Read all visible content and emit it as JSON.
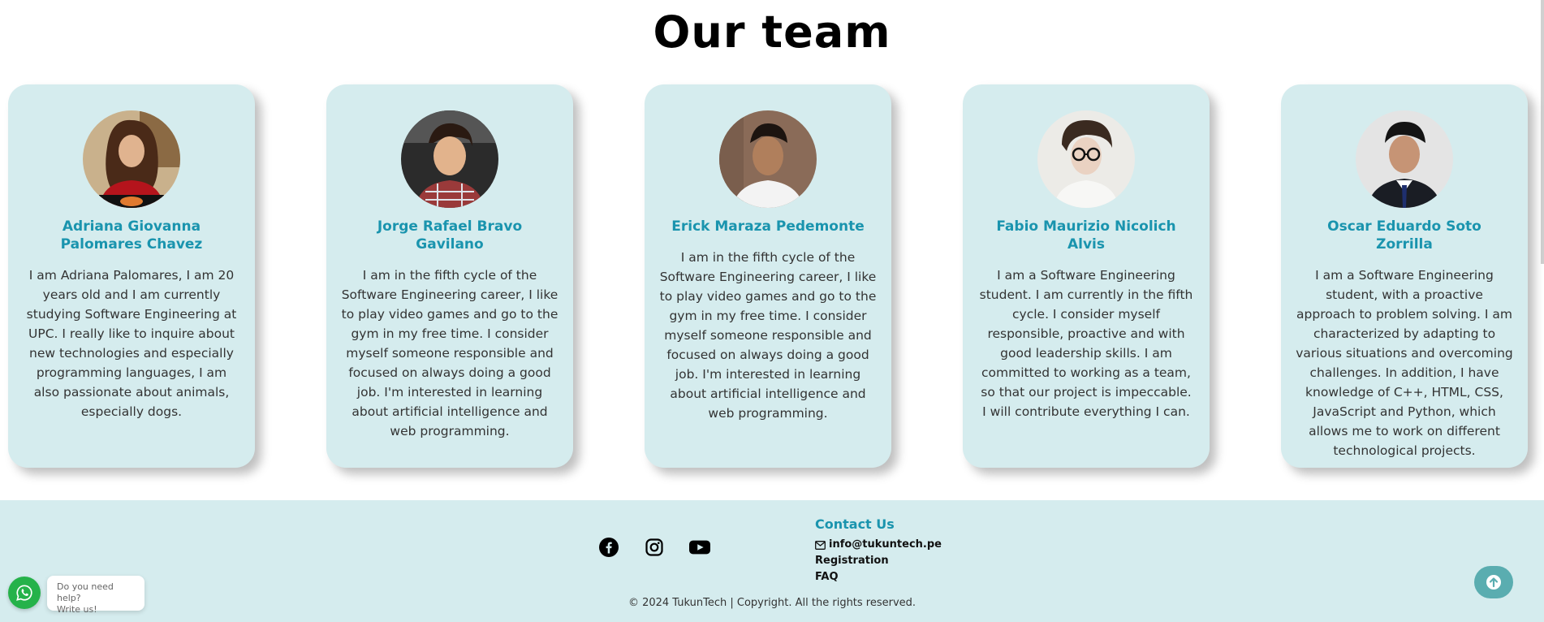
{
  "section": {
    "title": "Our team"
  },
  "team": [
    {
      "name": "Adriana Giovanna Palomares Chavez",
      "bio": "I am Adriana Palomares, I am 20 years old and I am currently studying Software Engineering at UPC. I really like to inquire about new technologies and especially programming languages, I am also passionate about animals, especially dogs."
    },
    {
      "name": "Jorge Rafael Bravo Gavilano",
      "bio": "I am in the fifth cycle of the Software Engineering career, I like to play video games and go to the gym in my free time. I consider myself someone responsible and focused on always doing a good job. I'm interested in learning about artificial intelligence and web programming."
    },
    {
      "name": "Erick Maraza Pedemonte",
      "bio": "I am in the fifth cycle of the Software Engineering career, I like to play video games and go to the gym in my free time. I consider myself someone responsible and focused on always doing a good job. I'm interested in learning about artificial intelligence and web programming."
    },
    {
      "name": "Fabio Maurizio Nicolich Alvis",
      "bio": "I am a Software Engineering student. I am currently in the fifth cycle. I consider myself responsible, proactive and with good leadership skills. I am committed to working as a team, so that our project is impeccable. I will contribute everything I can."
    },
    {
      "name": "Oscar Eduardo Soto Zorrilla",
      "bio": "I am a Software Engineering student, with a proactive approach to problem solving. I am characterized by adapting to various situations and overcoming challenges. In addition, I have knowledge of C++, HTML, CSS, JavaScript and Python, which allows me to work on different technological projects."
    }
  ],
  "footer": {
    "social": [
      "facebook-icon",
      "instagram-icon",
      "youtube-icon"
    ],
    "contact_title": "Contact Us",
    "email": "info@tukuntech.pe",
    "registration": "Registration",
    "faq": "FAQ",
    "copyright": "© 2024 TukunTech | Copyright. All the rights reserved."
  },
  "chat_widget": {
    "line1": "Do you need help?",
    "line2": "Write us!"
  },
  "colors": {
    "accent": "#1a94ae",
    "card_bg": "#d5ecee",
    "whatsapp": "#25b24a",
    "to_top": "#5aadb0"
  }
}
